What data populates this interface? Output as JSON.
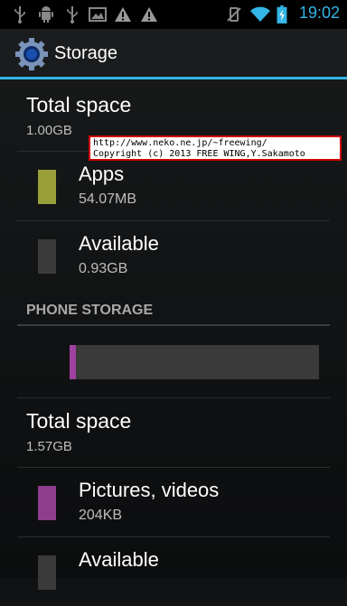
{
  "status_bar": {
    "time": "19:02",
    "icons": [
      "usb-icon",
      "android-debug-icon",
      "usb-icon",
      "image-icon",
      "warning-icon",
      "warning-icon",
      "vibrate-icon",
      "wifi-icon",
      "battery-charging-icon"
    ],
    "accent_color": "#33b5e5"
  },
  "action_bar": {
    "title": "Storage",
    "icon": "settings-gear-icon"
  },
  "internal": {
    "total_label": "Total space",
    "total_value": "1.00GB",
    "items": [
      {
        "label": "Apps",
        "size": "54.07MB",
        "color": "#99a03a"
      },
      {
        "label": "Available",
        "size": "0.93GB",
        "color": "#3a3a3a"
      }
    ]
  },
  "phone_storage": {
    "header": "PHONE STORAGE",
    "usage_fraction": 0.025,
    "usage_color": "#a040a0",
    "total_label": "Total space",
    "total_value": "1.57GB",
    "items": [
      {
        "label": "Pictures, videos",
        "size": "204KB",
        "color": "#8e3d8e"
      },
      {
        "label": "Available",
        "size": "",
        "color": "#3a3a3a"
      }
    ]
  },
  "watermark": {
    "line1": "http://www.neko.ne.jp/~freewing/",
    "line2": "Copyright (c) 2013 FREE WING,Y.Sakamoto"
  }
}
